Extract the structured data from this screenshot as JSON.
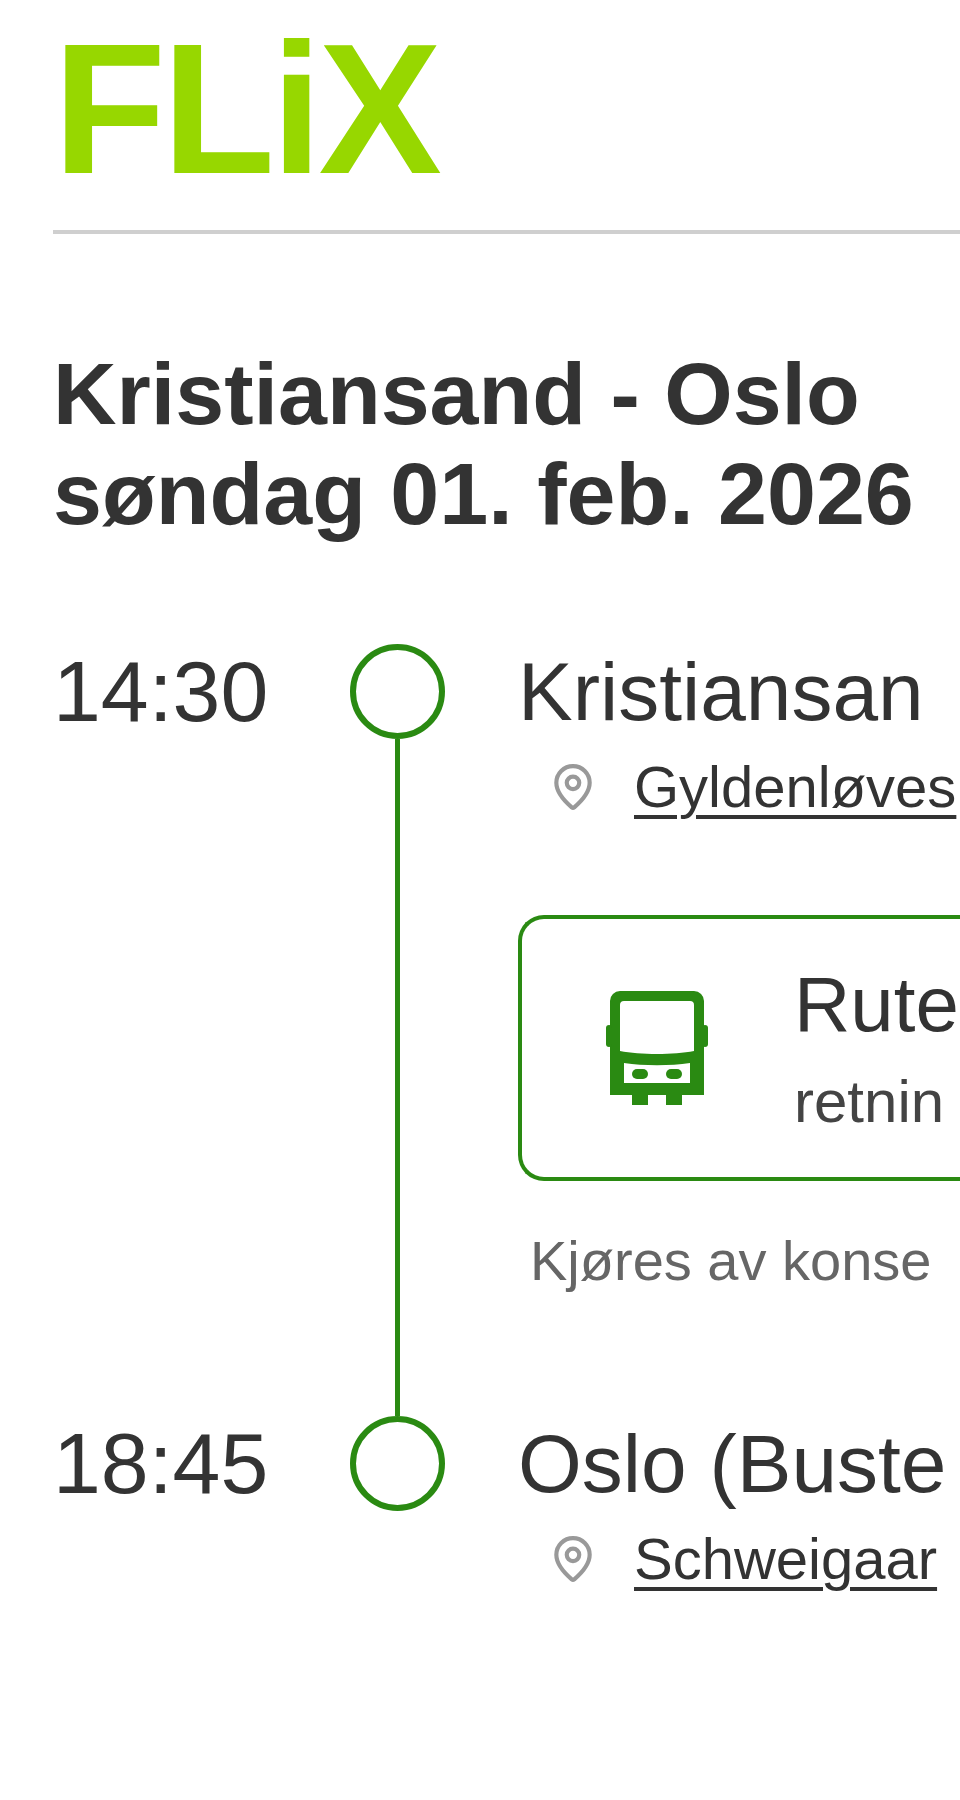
{
  "logo": {
    "text": "FLiX"
  },
  "trip": {
    "route": "Kristiansand - Oslo",
    "date": "søndag 01. feb. 2026"
  },
  "stops": [
    {
      "time": "14:30",
      "name": "Kristiansan",
      "address": "Gyldenløves"
    },
    {
      "time": "18:45",
      "name": "Oslo (Buste",
      "address": "Schweigaar"
    }
  ],
  "service": {
    "title": "Rute",
    "subtitle": "retnin"
  },
  "note": "Kjøres av konse"
}
